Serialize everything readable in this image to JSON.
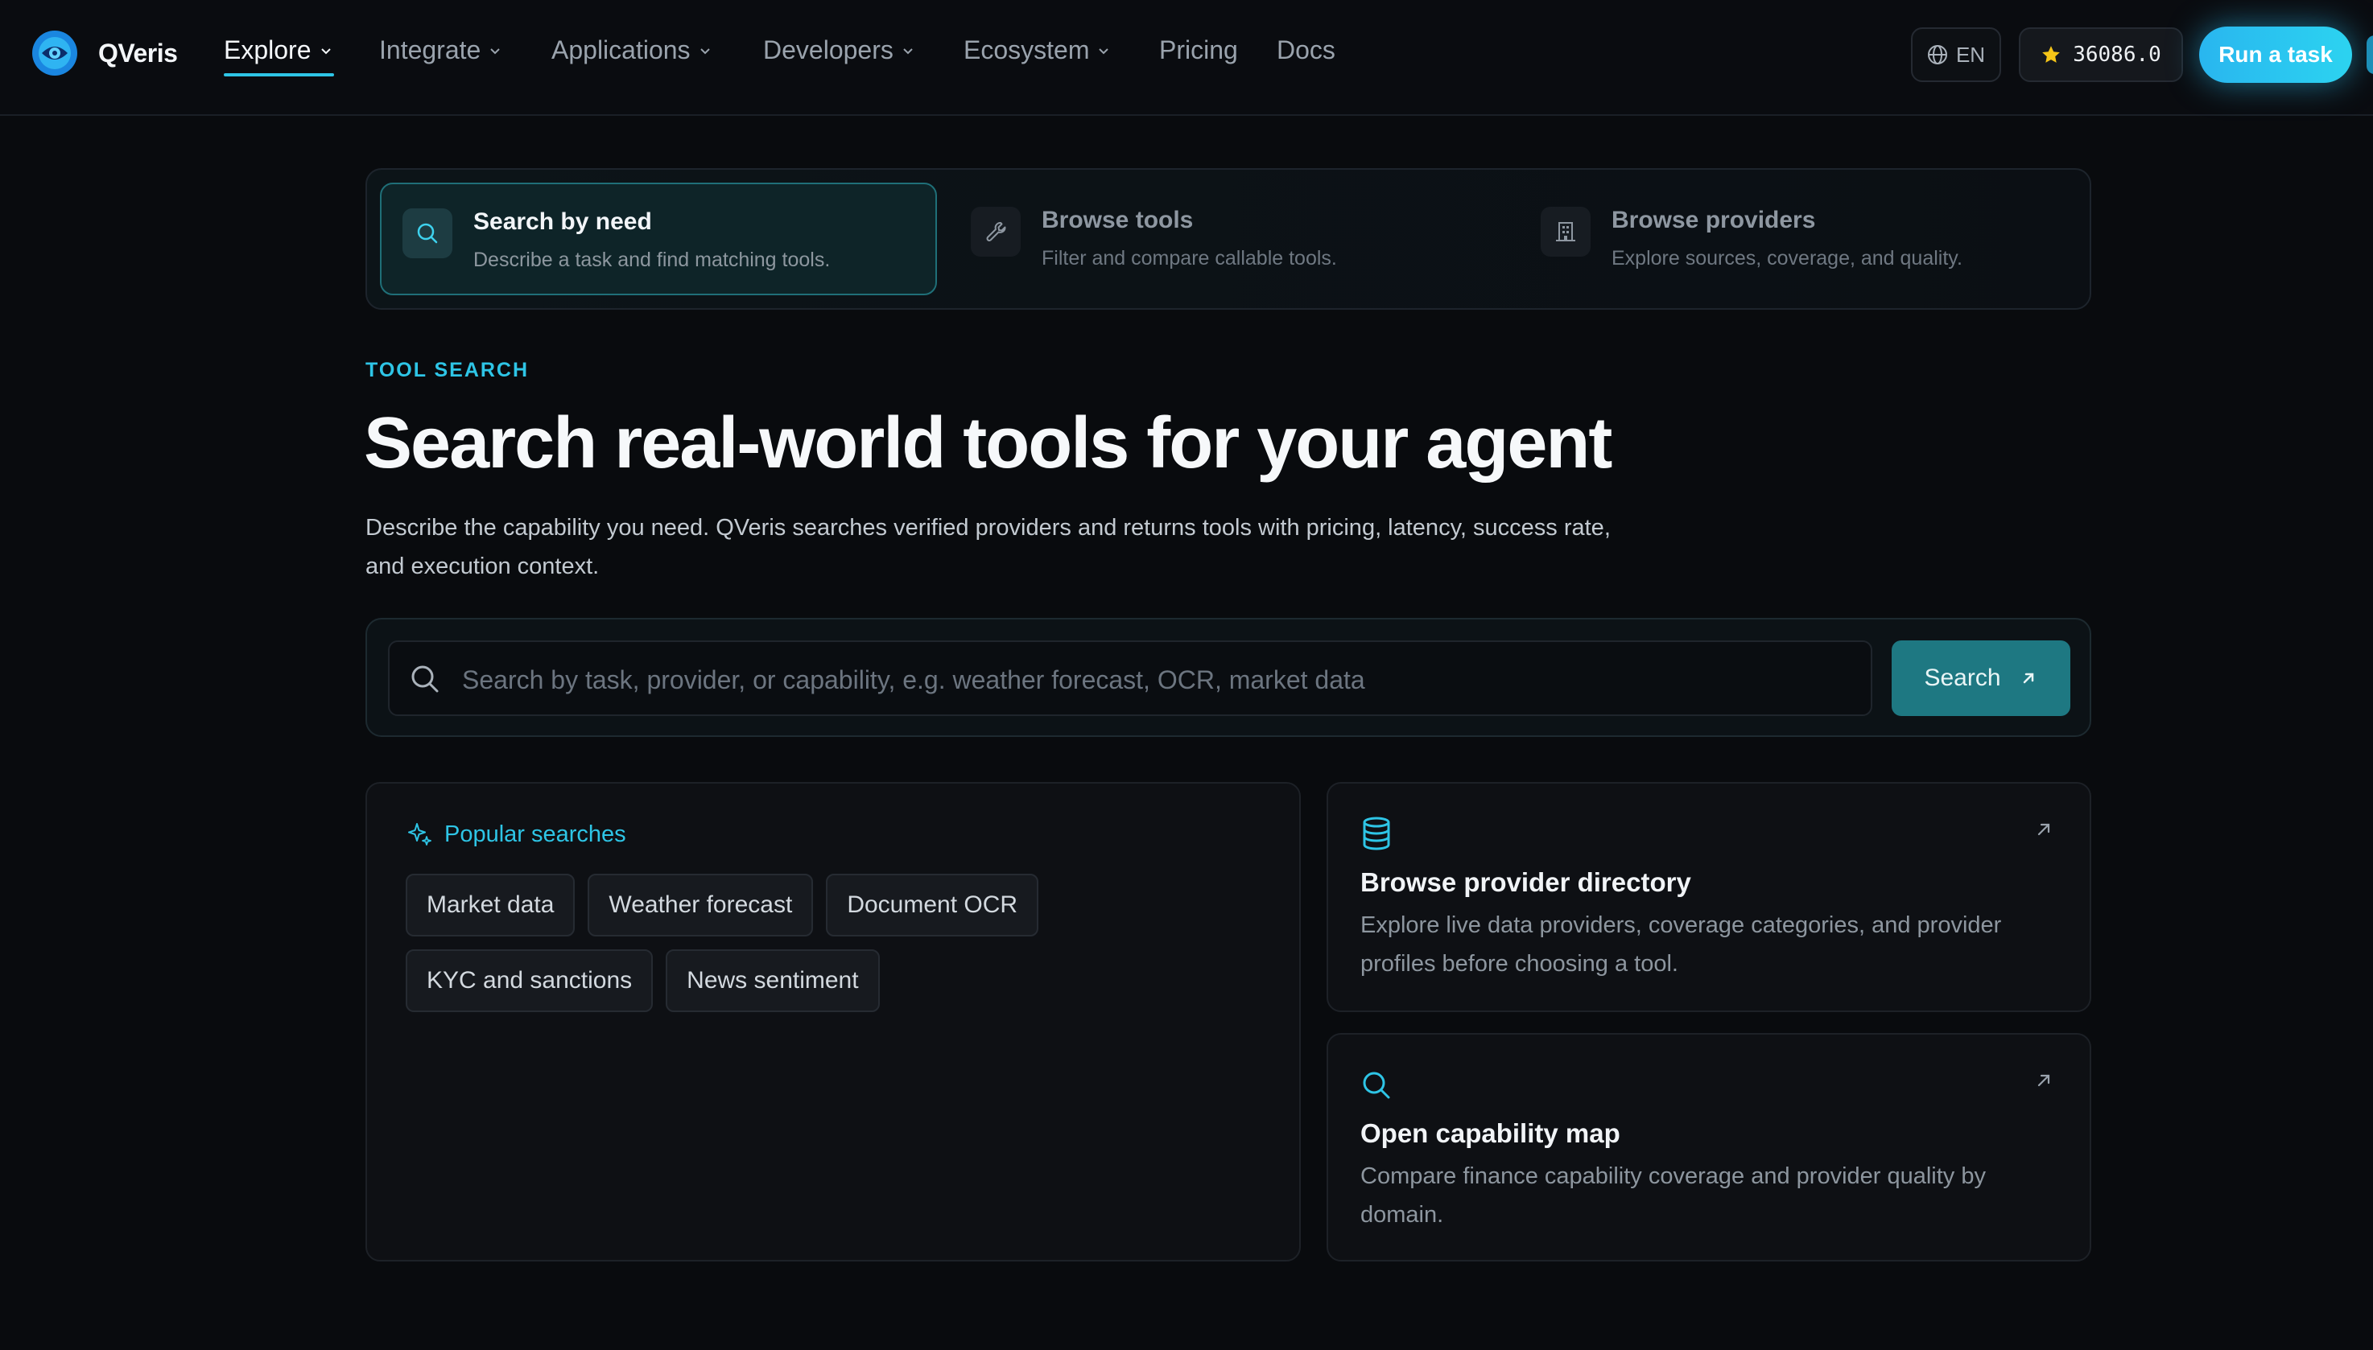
{
  "brand": {
    "name": "QVeris"
  },
  "nav": [
    {
      "label": "Explore",
      "dropdown": true,
      "active": true
    },
    {
      "label": "Integrate",
      "dropdown": true
    },
    {
      "label": "Applications",
      "dropdown": true
    },
    {
      "label": "Developers",
      "dropdown": true
    },
    {
      "label": "Ecosystem",
      "dropdown": true
    },
    {
      "label": "Pricing",
      "dropdown": false
    },
    {
      "label": "Docs",
      "dropdown": false
    }
  ],
  "header": {
    "language": "EN",
    "stars": "36086.0",
    "cta": "Run a task"
  },
  "modes": [
    {
      "title": "Search by need",
      "desc": "Describe a task and find matching tools.",
      "icon": "search-icon",
      "selected": true
    },
    {
      "title": "Browse tools",
      "desc": "Filter and compare callable tools.",
      "icon": "wrench-icon",
      "selected": false
    },
    {
      "title": "Browse providers",
      "desc": "Explore sources, coverage, and quality.",
      "icon": "building-icon",
      "selected": false
    }
  ],
  "hero": {
    "eyebrow": "TOOL SEARCH",
    "title": "Search real-world tools for your agent",
    "lead": "Describe the capability you need. QVeris searches verified providers and returns tools with pricing, latency, success rate, and execution context."
  },
  "search": {
    "placeholder": "Search by task, provider, or capability, e.g. weather forecast, OCR, market data",
    "value": "",
    "button": "Search"
  },
  "popular": {
    "heading": "Popular searches",
    "chips": [
      "Market data",
      "Weather forecast",
      "Document OCR",
      "KYC and sanctions",
      "News sentiment"
    ]
  },
  "cards": [
    {
      "title": "Browse provider directory",
      "desc": "Explore live data providers, coverage categories, and provider profiles before choosing a tool.",
      "icon": "database-icon"
    },
    {
      "title": "Open capability map",
      "desc": "Compare finance capability coverage and provider quality by domain.",
      "icon": "search-icon"
    }
  ],
  "colors": {
    "accent": "#2ec5e6",
    "button": "#1e7882",
    "cta": "#29b6ef",
    "star": "#f5c518",
    "background": "#090b0e"
  }
}
